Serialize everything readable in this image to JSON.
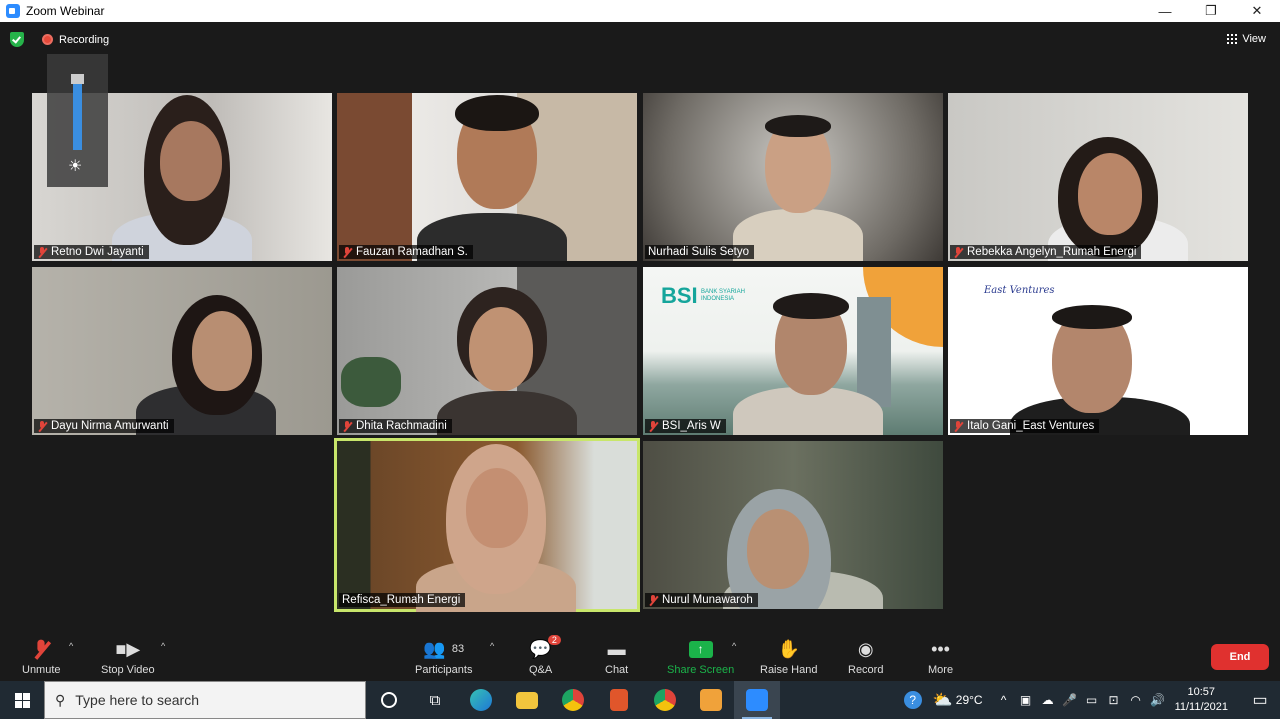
{
  "window": {
    "title": "Zoom Webinar",
    "minimize": "—",
    "restore": "❐",
    "close": "✕"
  },
  "topbar": {
    "recording_label": "Recording",
    "view_label": "View"
  },
  "participants": [
    {
      "name": "Retno Dwi Jayanti",
      "muted": true
    },
    {
      "name": "Fauzan Ramadhan S.",
      "muted": true
    },
    {
      "name": "Nurhadi Sulis Setyo",
      "muted": false
    },
    {
      "name": "Rebekka Angelyn_Rumah Energi",
      "muted": true
    },
    {
      "name": "Dayu Nirma Amurwanti",
      "muted": true
    },
    {
      "name": "Dhita Rachmadini",
      "muted": true
    },
    {
      "name": "BSI_Aris W",
      "muted": true
    },
    {
      "name": "Italo Gani_East Ventures",
      "muted": true
    },
    {
      "name": "Refisca_Rumah Energi",
      "muted": false,
      "active_speaker": true
    },
    {
      "name": "Nurul Munawaroh",
      "muted": true
    }
  ],
  "backgrounds": {
    "bsi_logo": "BSI",
    "bsi_sub": "BANK SYARIAH INDONESIA",
    "ev_logo": "East Ventures"
  },
  "toolbar": {
    "unmute": "Unmute",
    "stop_video": "Stop Video",
    "participants": "Participants",
    "participants_count": "83",
    "qa": "Q&A",
    "qa_badge": "2",
    "chat": "Chat",
    "share_screen": "Share Screen",
    "raise_hand": "Raise Hand",
    "record": "Record",
    "more": "More",
    "end": "End"
  },
  "taskbar": {
    "search_placeholder": "Type here to search",
    "temperature": "29°C",
    "time": "10:57",
    "date": "11/11/2021"
  },
  "colors": {
    "active_border": "#c8e66b",
    "end_button": "#e0312f",
    "share_green": "#1bb34a"
  }
}
